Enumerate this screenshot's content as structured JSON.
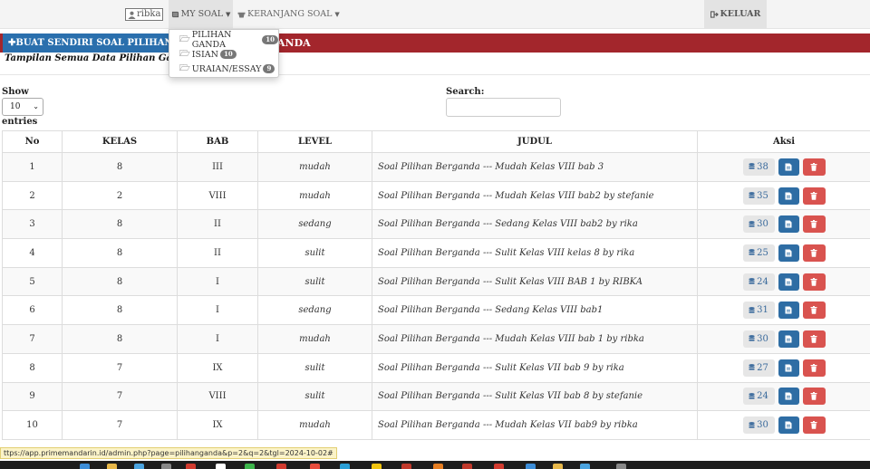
{
  "navbar": {
    "user": "ribka",
    "my_soal": "MY SOAL",
    "keranjang": "KERANJANG SOAL",
    "keluar": "KELUAR"
  },
  "dropdown": {
    "items": [
      {
        "label": "PILIHAN GANDA",
        "count": "10"
      },
      {
        "label": "ISIAN",
        "count": "10"
      },
      {
        "label": "URAIAN/ESSAY",
        "count": "9"
      }
    ]
  },
  "banner": {
    "create_button": "BUAT SENDIRI SOAL PILIHAN GANDA",
    "title_visible": "ANDA"
  },
  "subtitle": "Tampilan Semua Data Pilihan Ganda",
  "controls": {
    "show_label": "Show",
    "entries_value": "10",
    "entries_label": "entries",
    "search_label": "Search:",
    "search_value": ""
  },
  "table": {
    "headers": [
      "No",
      "KELAS",
      "BAB",
      "LEVEL",
      "JUDUL",
      "Aksi"
    ],
    "rows": [
      {
        "no": "1",
        "kelas": "8",
        "bab": "III",
        "level": "mudah",
        "judul": "Soal Pilihan Berganda --- Mudah Kelas VIII bab 3",
        "count": "38"
      },
      {
        "no": "2",
        "kelas": "2",
        "bab": "VIII",
        "level": "mudah",
        "judul": "Soal Pilihan Berganda --- Mudah Kelas VIII bab2 by stefanie",
        "count": "35"
      },
      {
        "no": "3",
        "kelas": "8",
        "bab": "II",
        "level": "sedang",
        "judul": "Soal Pilihan Berganda --- Sedang Kelas VIII bab2 by rika",
        "count": "30"
      },
      {
        "no": "4",
        "kelas": "8",
        "bab": "II",
        "level": "sulit",
        "judul": "Soal Pilihan Berganda --- Sulit Kelas VIII kelas 8 by rika",
        "count": "25"
      },
      {
        "no": "5",
        "kelas": "8",
        "bab": "I",
        "level": "sulit",
        "judul": "Soal Pilihan Berganda --- Sulit Kelas VIII BAB 1 by RIBKA",
        "count": "24"
      },
      {
        "no": "6",
        "kelas": "8",
        "bab": "I",
        "level": "sedang",
        "judul": "Soal Pilihan Berganda --- Sedang Kelas VIII bab1",
        "count": "31"
      },
      {
        "no": "7",
        "kelas": "8",
        "bab": "I",
        "level": "mudah",
        "judul": "Soal Pilihan Berganda --- Mudah Kelas VIII bab 1 by ribka",
        "count": "30"
      },
      {
        "no": "8",
        "kelas": "7",
        "bab": "IX",
        "level": "sulit",
        "judul": "Soal Pilihan Berganda --- Sulit Kelas VII bab 9 by rika",
        "count": "27"
      },
      {
        "no": "9",
        "kelas": "7",
        "bab": "VIII",
        "level": "sulit",
        "judul": "Soal Pilihan Berganda --- Sulit Kelas VII bab 8 by stefanie",
        "count": "24"
      },
      {
        "no": "10",
        "kelas": "7",
        "bab": "IX",
        "level": "mudah",
        "judul": "Soal Pilihan Berganda --- Mudah Kelas VII bab9 by ribka",
        "count": "30"
      }
    ]
  },
  "status_url": "ttps://app.primemandarin.id/admin.php?page=pilihanganda&p=2&q=2&tgl=2024-10-02#",
  "colors": {
    "banner_red": "#a3262c",
    "primary_blue": "#2e6da4",
    "danger_red": "#d9534f"
  },
  "icons": {
    "user": "user-icon",
    "book": "book-icon",
    "basket": "basket-icon",
    "logout": "sign-out-icon",
    "folder": "folder-open-icon",
    "plus": "plus-icon",
    "database": "database-icon",
    "edit": "file-text-icon",
    "delete": "trash-icon"
  }
}
